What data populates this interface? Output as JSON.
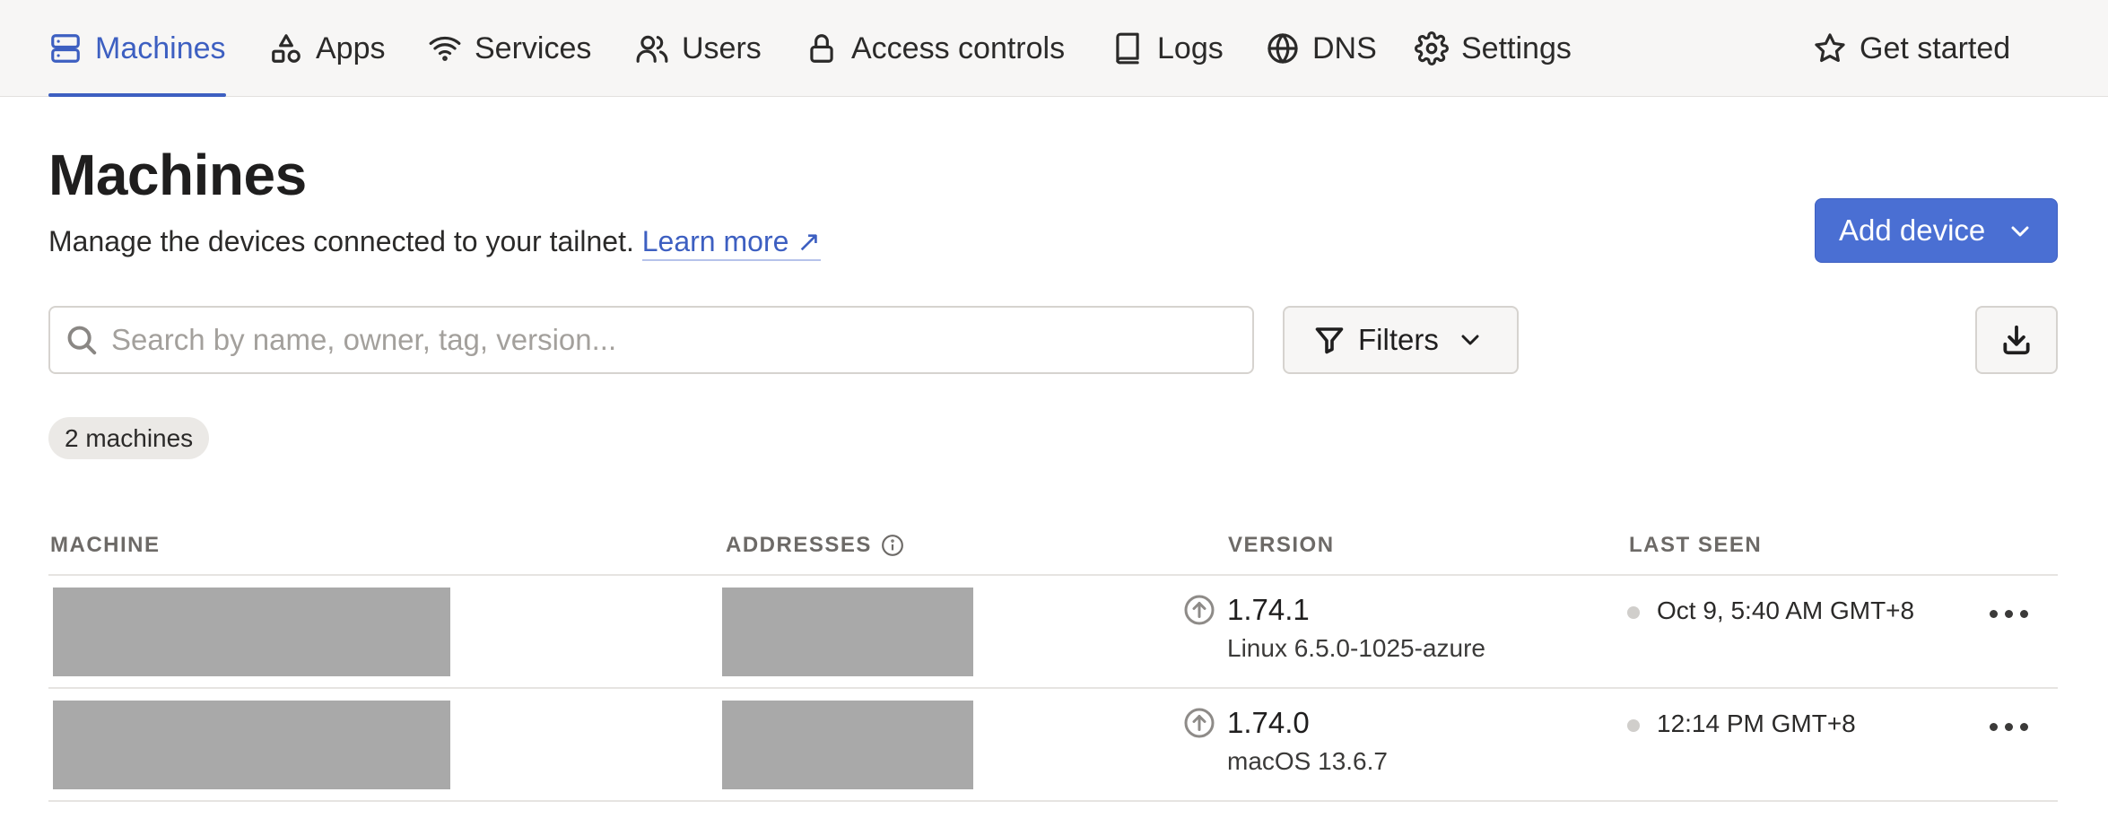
{
  "nav": {
    "items": [
      {
        "label": "Machines",
        "icon": "server-icon"
      },
      {
        "label": "Apps",
        "icon": "apps-shapes-icon"
      },
      {
        "label": "Services",
        "icon": "wifi-icon"
      },
      {
        "label": "Users",
        "icon": "users-icon"
      },
      {
        "label": "Access controls",
        "icon": "lock-icon"
      },
      {
        "label": "Logs",
        "icon": "book-icon"
      },
      {
        "label": "DNS",
        "icon": "globe-icon"
      },
      {
        "label": "Settings",
        "icon": "gear-icon"
      }
    ],
    "get_started": {
      "label": "Get started",
      "icon": "star-icon"
    },
    "active": "Machines",
    "accent_color": "#3d5fc1"
  },
  "header": {
    "title": "Machines",
    "subtitle": "Manage the devices connected to your tailnet.",
    "learn_more": "Learn more ↗",
    "add_device": "Add device"
  },
  "toolbar": {
    "search_placeholder": "Search by name, owner, tag, version...",
    "filters_label": "Filters"
  },
  "count_label": "2 machines",
  "table": {
    "columns": [
      "MACHINE",
      "ADDRESSES",
      "VERSION",
      "LAST SEEN"
    ],
    "rows": [
      {
        "machine": "",
        "addresses": "",
        "version": "1.74.1",
        "os": "Linux 6.5.0-1025-azure",
        "last_seen": "Oct 9, 5:40 AM GMT+8"
      },
      {
        "machine": "",
        "addresses": "",
        "version": "1.74.0",
        "os": "macOS 13.6.7",
        "last_seen": "12:14 PM GMT+8"
      }
    ]
  }
}
